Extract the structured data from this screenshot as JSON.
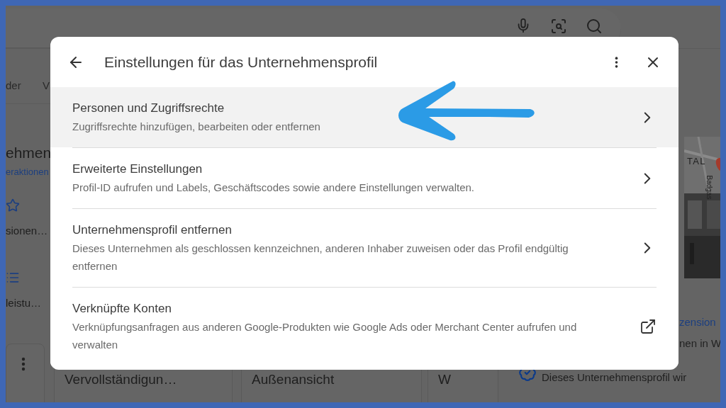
{
  "background": {
    "tabs": [
      "der",
      "V"
    ],
    "heading": "ehmen",
    "link": "eraktionen",
    "shortcuts": [
      {
        "kind": "star",
        "label": "sionen…"
      },
      {
        "kind": "list",
        "label": "leistu…"
      }
    ],
    "cards": [
      "Vervollständigun…",
      "Außenansicht",
      "W"
    ],
    "map_labels": [
      "TAL",
      "Badgas"
    ],
    "reviews_link": "zension",
    "reviews_text": "nen in W",
    "verified_text": "Dieses Unternehmensprofil wir"
  },
  "dialog": {
    "title": "Einstellungen für das Unternehmensprofil",
    "items": [
      {
        "title": "Personen und Zugriffsrechte",
        "subtitle": "Zugriffsrechte hinzufügen, bearbeiten oder entfernen",
        "kind": "chevron",
        "selected": true
      },
      {
        "title": "Erweiterte Einstellungen",
        "subtitle": "Profil-ID aufrufen und Labels, Geschäftscodes sowie andere Einstellungen verwalten.",
        "kind": "chevron",
        "selected": false
      },
      {
        "title": "Unternehmensprofil entfernen",
        "subtitle": "Dieses Unternehmen als geschlossen kennzeichnen, anderen Inhaber zuweisen oder das Profil endgültig entfernen",
        "kind": "chevron",
        "selected": false
      },
      {
        "title": "Verknüpfte Konten",
        "subtitle": "Verknüpfungsanfragen aus anderen Google-Produkten wie Google Ads oder Merchant Center aufrufen und verwalten",
        "kind": "external",
        "selected": false
      }
    ]
  }
}
